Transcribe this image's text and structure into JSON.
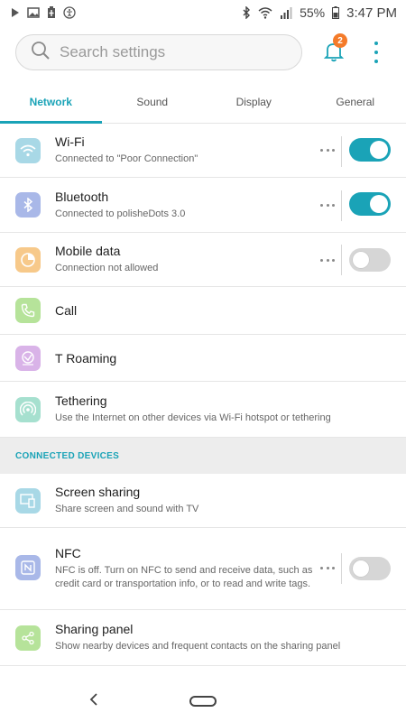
{
  "status_bar": {
    "battery": "55%",
    "time": "3:47 PM"
  },
  "search": {
    "placeholder": "Search settings"
  },
  "notifications": {
    "count": "2"
  },
  "tabs": [
    {
      "label": "Network",
      "active": true
    },
    {
      "label": "Sound",
      "active": false
    },
    {
      "label": "Display",
      "active": false
    },
    {
      "label": "General",
      "active": false
    }
  ],
  "network": {
    "wifi": {
      "title": "Wi-Fi",
      "subtitle": "Connected to \"Poor Connection\"",
      "toggle": "on"
    },
    "bluetooth": {
      "title": "Bluetooth",
      "subtitle": "Connected to polisheDots 3.0",
      "toggle": "on"
    },
    "mobile_data": {
      "title": "Mobile data",
      "subtitle": "Connection not allowed",
      "toggle": "off"
    },
    "call": {
      "title": "Call"
    },
    "t_roaming": {
      "title": "T Roaming"
    },
    "tethering": {
      "title": "Tethering",
      "subtitle": "Use the Internet on other devices via Wi-Fi hotspot or tethering"
    }
  },
  "connected_devices": {
    "header": "CONNECTED DEVICES",
    "screen_sharing": {
      "title": "Screen sharing",
      "subtitle": "Share screen and sound with TV"
    },
    "nfc": {
      "title": "NFC",
      "subtitle": "NFC is off. Turn on NFC to send and receive data, such as credit card or transportation info, or to read and write tags.",
      "toggle": "off"
    },
    "sharing_panel": {
      "title": "Sharing panel",
      "subtitle": "Show nearby devices and frequent contacts on the sharing panel"
    }
  },
  "colors": {
    "accent": "#1aa3b7",
    "badge": "#f47b2a",
    "wifi_icon_bg": "#a8d8e6",
    "bluetooth_icon_bg": "#a9b8e8",
    "mobile_data_icon_bg": "#f7c98a",
    "call_icon_bg": "#b6e39a",
    "roaming_icon_bg": "#d9b3e8",
    "tethering_icon_bg": "#a6e0cf",
    "screen_share_icon_bg": "#a8d8e6",
    "nfc_icon_bg": "#a9b8e8",
    "sharing_panel_icon_bg": "#b6e39a"
  }
}
